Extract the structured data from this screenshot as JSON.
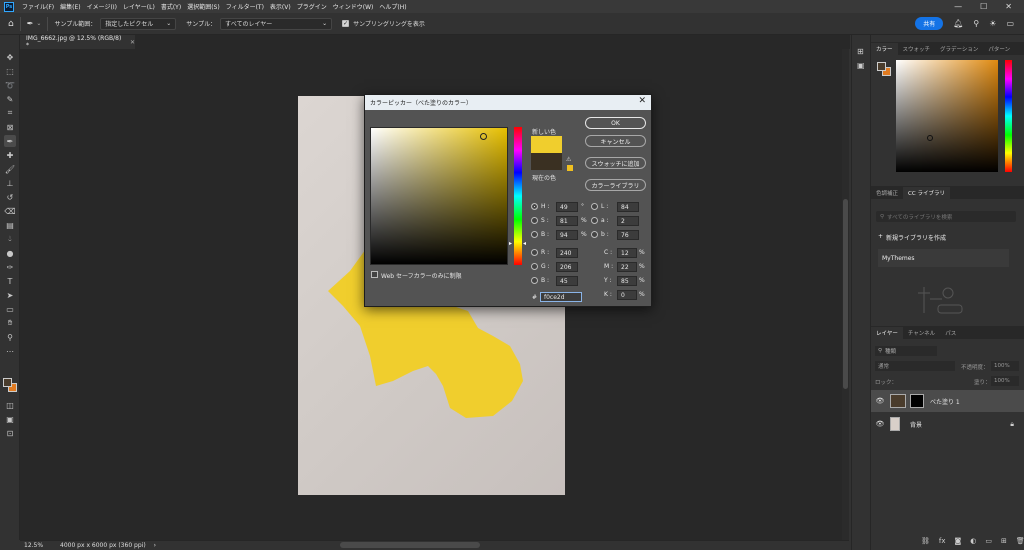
{
  "menubar": {
    "logo": "Ps",
    "items": [
      "ファイル(F)",
      "編集(E)",
      "イメージ(I)",
      "レイヤー(L)",
      "書式(Y)",
      "選択範囲(S)",
      "フィルター(T)",
      "表示(V)",
      "プラグイン",
      "ウィンドウ(W)",
      "ヘルプ(H)"
    ],
    "controls": [
      "—",
      "☐",
      "✕"
    ]
  },
  "options": {
    "sample_size_label": "サンプル範囲：",
    "sample_size_value": "指定したピクセル",
    "sample_label": "サンプル：",
    "sample_value": "すべてのレイヤー",
    "show_ring_label": "サンプリングリングを表示",
    "share_label": "共有"
  },
  "document_tab": {
    "title": "IMG_6662.jpg @ 12.5% (RGB/8) *"
  },
  "status": {
    "zoom": "12.5%",
    "size": "4000 px x 6000 px (360 ppi)"
  },
  "color_picker": {
    "title": "カラーピッカー（べた塗りのカラー）",
    "new_label": "新しい色",
    "current_label": "現在の色",
    "new_color": "#f0ce2d",
    "current_color": "#3a3022",
    "ok_label": "OK",
    "cancel_label": "キャンセル",
    "add_swatch_label": "スウォッチに追加",
    "libraries_label": "カラーライブラリ",
    "web_only_label": "Web セーフカラーのみに制限",
    "H": "49",
    "H_unit": "°",
    "S": "81",
    "S_unit": "%",
    "B": "94",
    "B_unit": "%",
    "R": "240",
    "G": "206",
    "Bv": "45",
    "L": "84",
    "a": "2",
    "b": "76",
    "C": "12",
    "M": "22",
    "Y": "85",
    "K": "0",
    "pct": "%",
    "hex_label": "#",
    "hex": "f0ce2d",
    "labels": {
      "H": "H :",
      "S": "S :",
      "B": "B :",
      "R": "R :",
      "G": "G :",
      "Bv": "B :",
      "L": "L :",
      "a": "a :",
      "b": "b :",
      "C": "C :",
      "M": "M :",
      "Y": "Y :",
      "K": "K :"
    }
  },
  "right_panel": {
    "color_tabs": [
      "カラー",
      "スウォッチ",
      "グラデーション",
      "パターン"
    ],
    "lib_tabs": [
      "色調補正",
      "CC ライブラリ"
    ],
    "lib_search": "すべてのライブラリを検索",
    "lib_create": "新規ライブラリを作成",
    "lib_item": "MyThemes",
    "layer_tabs": [
      "レイヤー",
      "チャンネル",
      "パス"
    ],
    "layer_kind": "種類",
    "blend_mode": "通常",
    "opacity_label": "不透明度：",
    "opacity_value": "100%",
    "lock_label": "ロック：",
    "fill_label": "塗り：",
    "fill_value": "100%",
    "layers": [
      {
        "name": "べた塗り 1",
        "selected": true
      },
      {
        "name": "背景",
        "selected": false
      }
    ]
  },
  "colors": {
    "accent": "#1473e6",
    "fill_yellow": "#f0ce2d"
  }
}
